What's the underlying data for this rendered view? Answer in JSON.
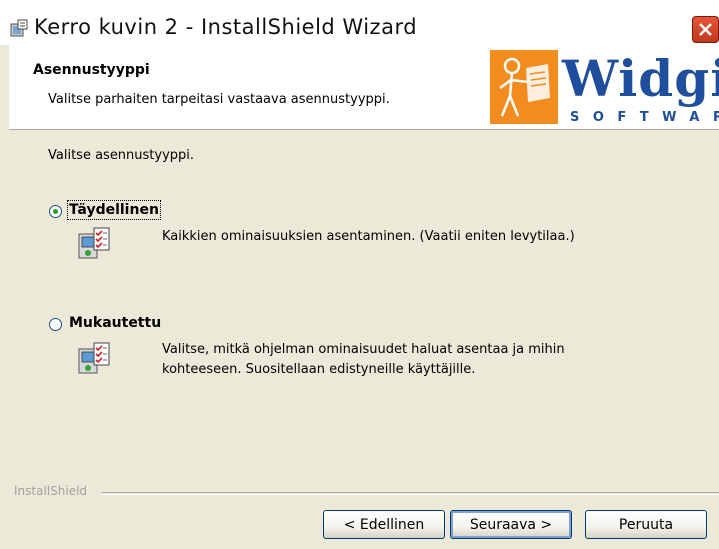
{
  "window": {
    "title": "Kerro kuvin 2 - InstallShield Wizard"
  },
  "header": {
    "title": "Asennustyyppi",
    "subtitle": "Valitse parhaiten tarpeitasi vastaava asennustyyppi.",
    "logo_text": "Widgit",
    "logo_sub": "SOFTWARE"
  },
  "main": {
    "intro": "Valitse asennustyyppi.",
    "options": [
      {
        "label": "Täydellinen",
        "selected": true,
        "description": "Kaikkien ominaisuuksien asentaminen. (Vaatii eniten levytilaa.)"
      },
      {
        "label": "Mukautettu",
        "selected": false,
        "description_line1": "Valitse, mitkä ohjelman ominaisuudet haluat asentaa ja mihin",
        "description_line2": "kohteeseen. Suositellaan edistyneille käyttäjille."
      }
    ]
  },
  "footer": {
    "brand": "InstallShield",
    "back_label": "< Edellinen",
    "next_label": "Seuraava >",
    "cancel_label": "Peruuta"
  },
  "colors": {
    "dialog_bg": "#ece9d8",
    "close_button": "#d8482b",
    "logo_orange": "#f28c1e",
    "logo_blue": "#1f4e9c",
    "radio_selected": "#21a121"
  },
  "icons": [
    "installer-icon",
    "close-icon",
    "widgit-logo",
    "setup-type-icon"
  ]
}
